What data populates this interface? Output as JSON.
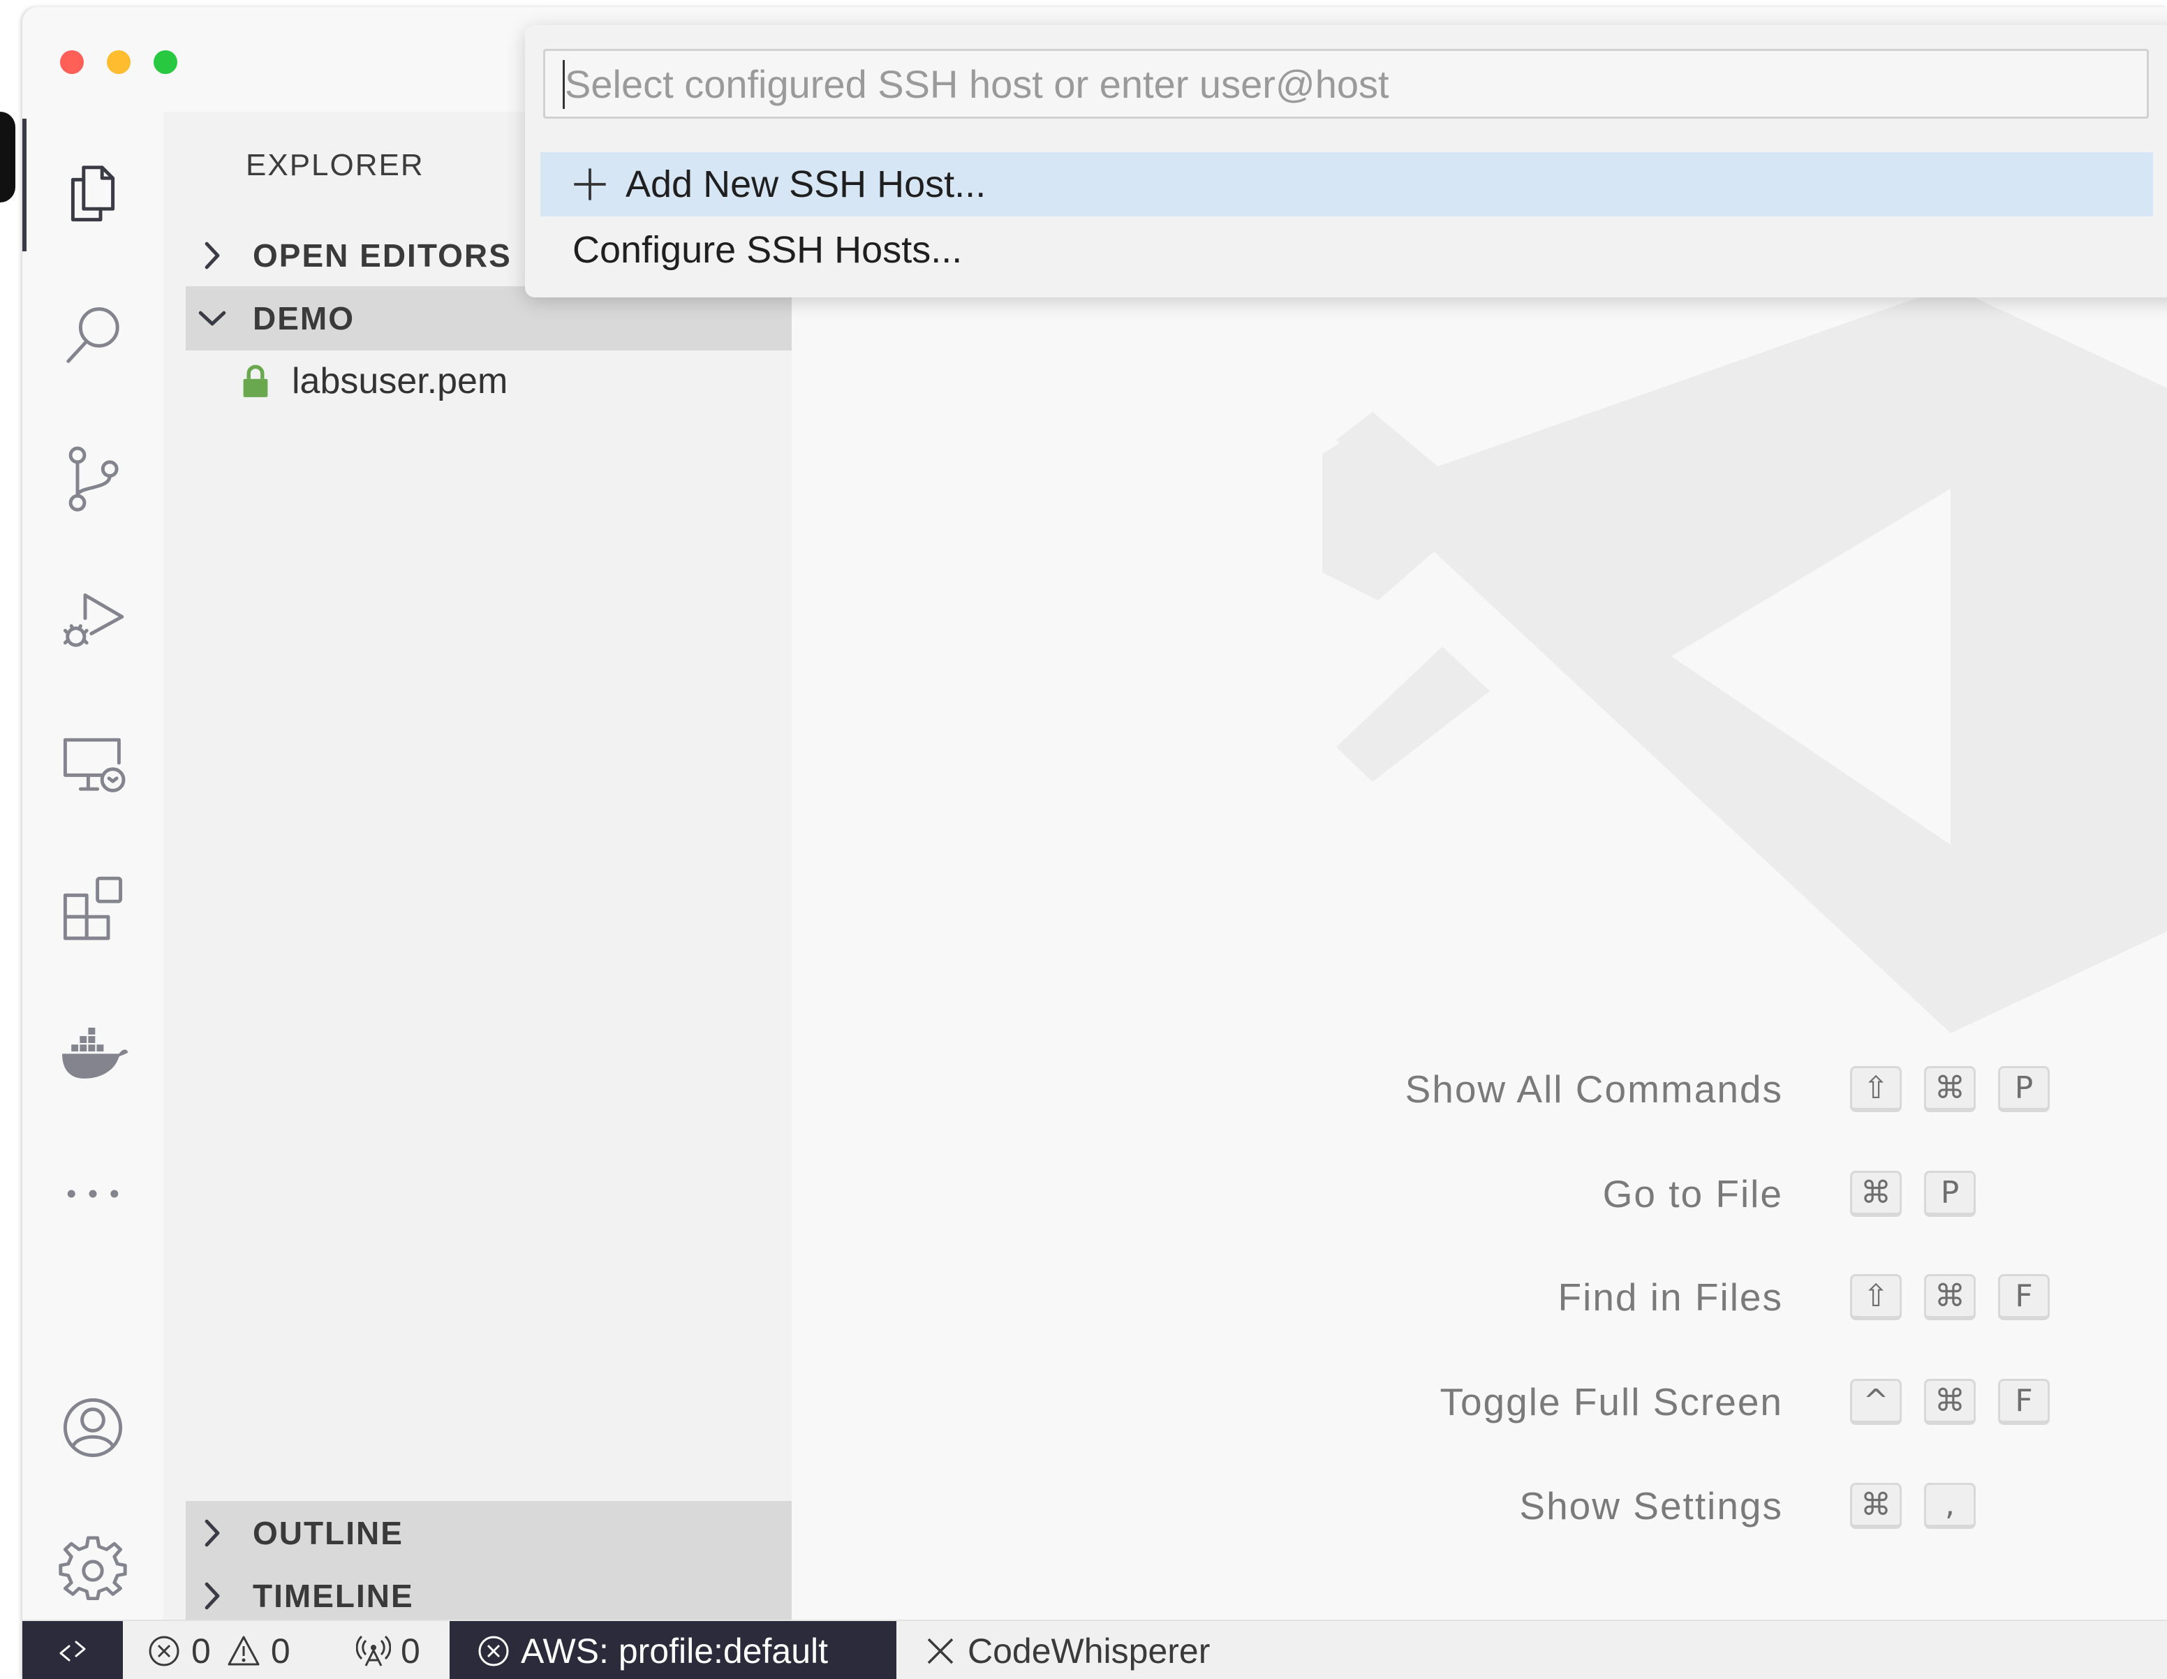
{
  "sidebar": {
    "title": "EXPLORER",
    "open_editors": "OPEN EDITORS",
    "folder": "DEMO",
    "file": "labsuser.pem",
    "outline": "OUTLINE",
    "timeline": "TIMELINE"
  },
  "activity_bar": {
    "icons": [
      "explorer-icon",
      "search-icon",
      "source-control-icon",
      "run-debug-icon",
      "remote-explorer-icon",
      "extensions-icon",
      "docker-icon",
      "more-icon",
      "account-icon",
      "settings-gear-icon"
    ]
  },
  "quick_pick": {
    "placeholder": "Select configured SSH host or enter user@host",
    "value": "",
    "items": [
      {
        "label": "Add New SSH Host...",
        "selected": true
      },
      {
        "label": "Configure SSH Hosts...",
        "selected": false
      }
    ]
  },
  "shortcuts": [
    {
      "label": "Show All Commands",
      "keys": [
        "⇧",
        "⌘",
        "P"
      ]
    },
    {
      "label": "Go to File",
      "keys": [
        "⌘",
        "P"
      ]
    },
    {
      "label": "Find in Files",
      "keys": [
        "⇧",
        "⌘",
        "F"
      ]
    },
    {
      "label": "Toggle Full Screen",
      "keys": [
        "^",
        "⌘",
        "F"
      ]
    },
    {
      "label": "Show Settings",
      "keys": [
        "⌘",
        ","
      ]
    }
  ],
  "status_bar": {
    "errors": "0",
    "warnings": "0",
    "ports": "0",
    "aws": "AWS: profile:default",
    "codewhisperer": "CodeWhisperer"
  },
  "colors": {
    "selection": "#d7e6f4",
    "status_dark": "#2b2b3c",
    "lock_green": "#6aa84f"
  }
}
